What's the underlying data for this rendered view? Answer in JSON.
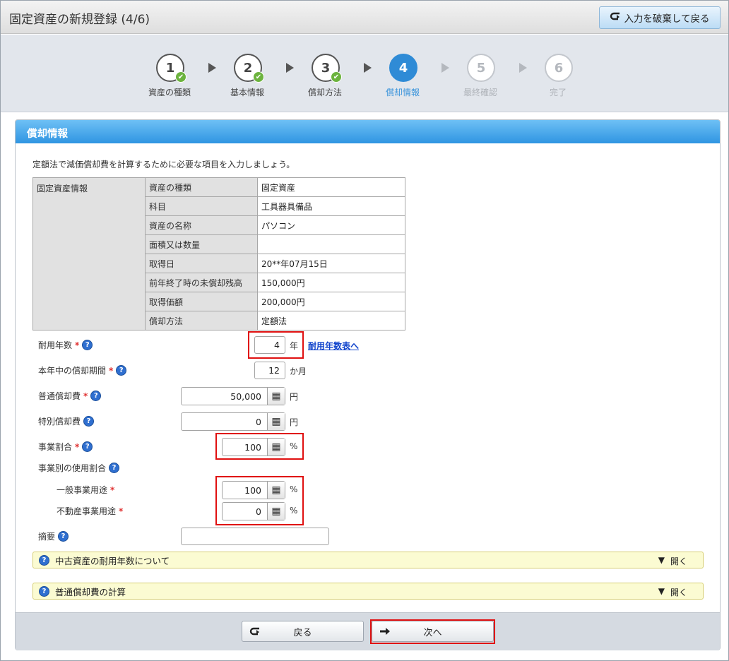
{
  "header": {
    "title": "固定資産の新規登録 (4/6)",
    "discard_label": "入力を破棄して戻る",
    "discard_icon": "return-arrow-icon"
  },
  "wizard": {
    "steps": [
      {
        "num": "1",
        "label": "資産の種類",
        "state": "done"
      },
      {
        "num": "2",
        "label": "基本情報",
        "state": "done"
      },
      {
        "num": "3",
        "label": "償却方法",
        "state": "done"
      },
      {
        "num": "4",
        "label": "償却情報",
        "state": "active"
      },
      {
        "num": "5",
        "label": "最終確認",
        "state": "future"
      },
      {
        "num": "6",
        "label": "完了",
        "state": "future"
      }
    ],
    "check_glyph": "✔"
  },
  "panel": {
    "title": "償却情報",
    "intro": "定額法で減価償却費を計算するために必要な項目を入力しましょう。"
  },
  "info_table": {
    "group_label": "固定資産情報",
    "rows": [
      {
        "key": "資産の種類",
        "value": "固定資産"
      },
      {
        "key": "科目",
        "value": "工具器具備品"
      },
      {
        "key": "資産の名称",
        "value": "パソコン"
      },
      {
        "key": "面積又は数量",
        "value": ""
      },
      {
        "key": "取得日",
        "value": "20**年07月15日"
      },
      {
        "key": "前年終了時の未償却残高",
        "value": "150,000円"
      },
      {
        "key": "取得価額",
        "value": "200,000円"
      },
      {
        "key": "償却方法",
        "value": "定額法"
      }
    ]
  },
  "form": {
    "useful_life": {
      "label": "耐用年数",
      "value": "4",
      "unit": "年",
      "link": "耐用年数表へ"
    },
    "period": {
      "label": "本年中の償却期間",
      "value": "12",
      "unit": "か月"
    },
    "normal_dep": {
      "label": "普通償却費",
      "value": "50,000",
      "unit": "円"
    },
    "special_dep": {
      "label": "特別償却費",
      "value": "0",
      "unit": "円"
    },
    "business_ratio": {
      "label": "事業割合",
      "value": "100",
      "unit": "%"
    },
    "usage_ratio": {
      "label": "事業別の使用割合"
    },
    "general": {
      "label": "一般事業用途",
      "value": "100",
      "unit": "%"
    },
    "real_estate": {
      "label": "不動産事業用途",
      "value": "0",
      "unit": "%"
    },
    "memo": {
      "label": "摘要",
      "value": ""
    },
    "required_mark": "*",
    "help_glyph": "?",
    "calc_glyph": "▦"
  },
  "accordions": [
    {
      "title": "中古資産の耐用年数について",
      "open_label": "開く"
    },
    {
      "title": "普通償却費の計算",
      "open_label": "開く"
    }
  ],
  "footer": {
    "back_label": "戻る",
    "back_icon": "return-arrow-icon",
    "next_label": "次へ",
    "next_icon": "right-arrow-icon"
  },
  "colors": {
    "accent": "#2f8bd6",
    "highlight": "#e01010",
    "done_check": "#6cb33e"
  }
}
